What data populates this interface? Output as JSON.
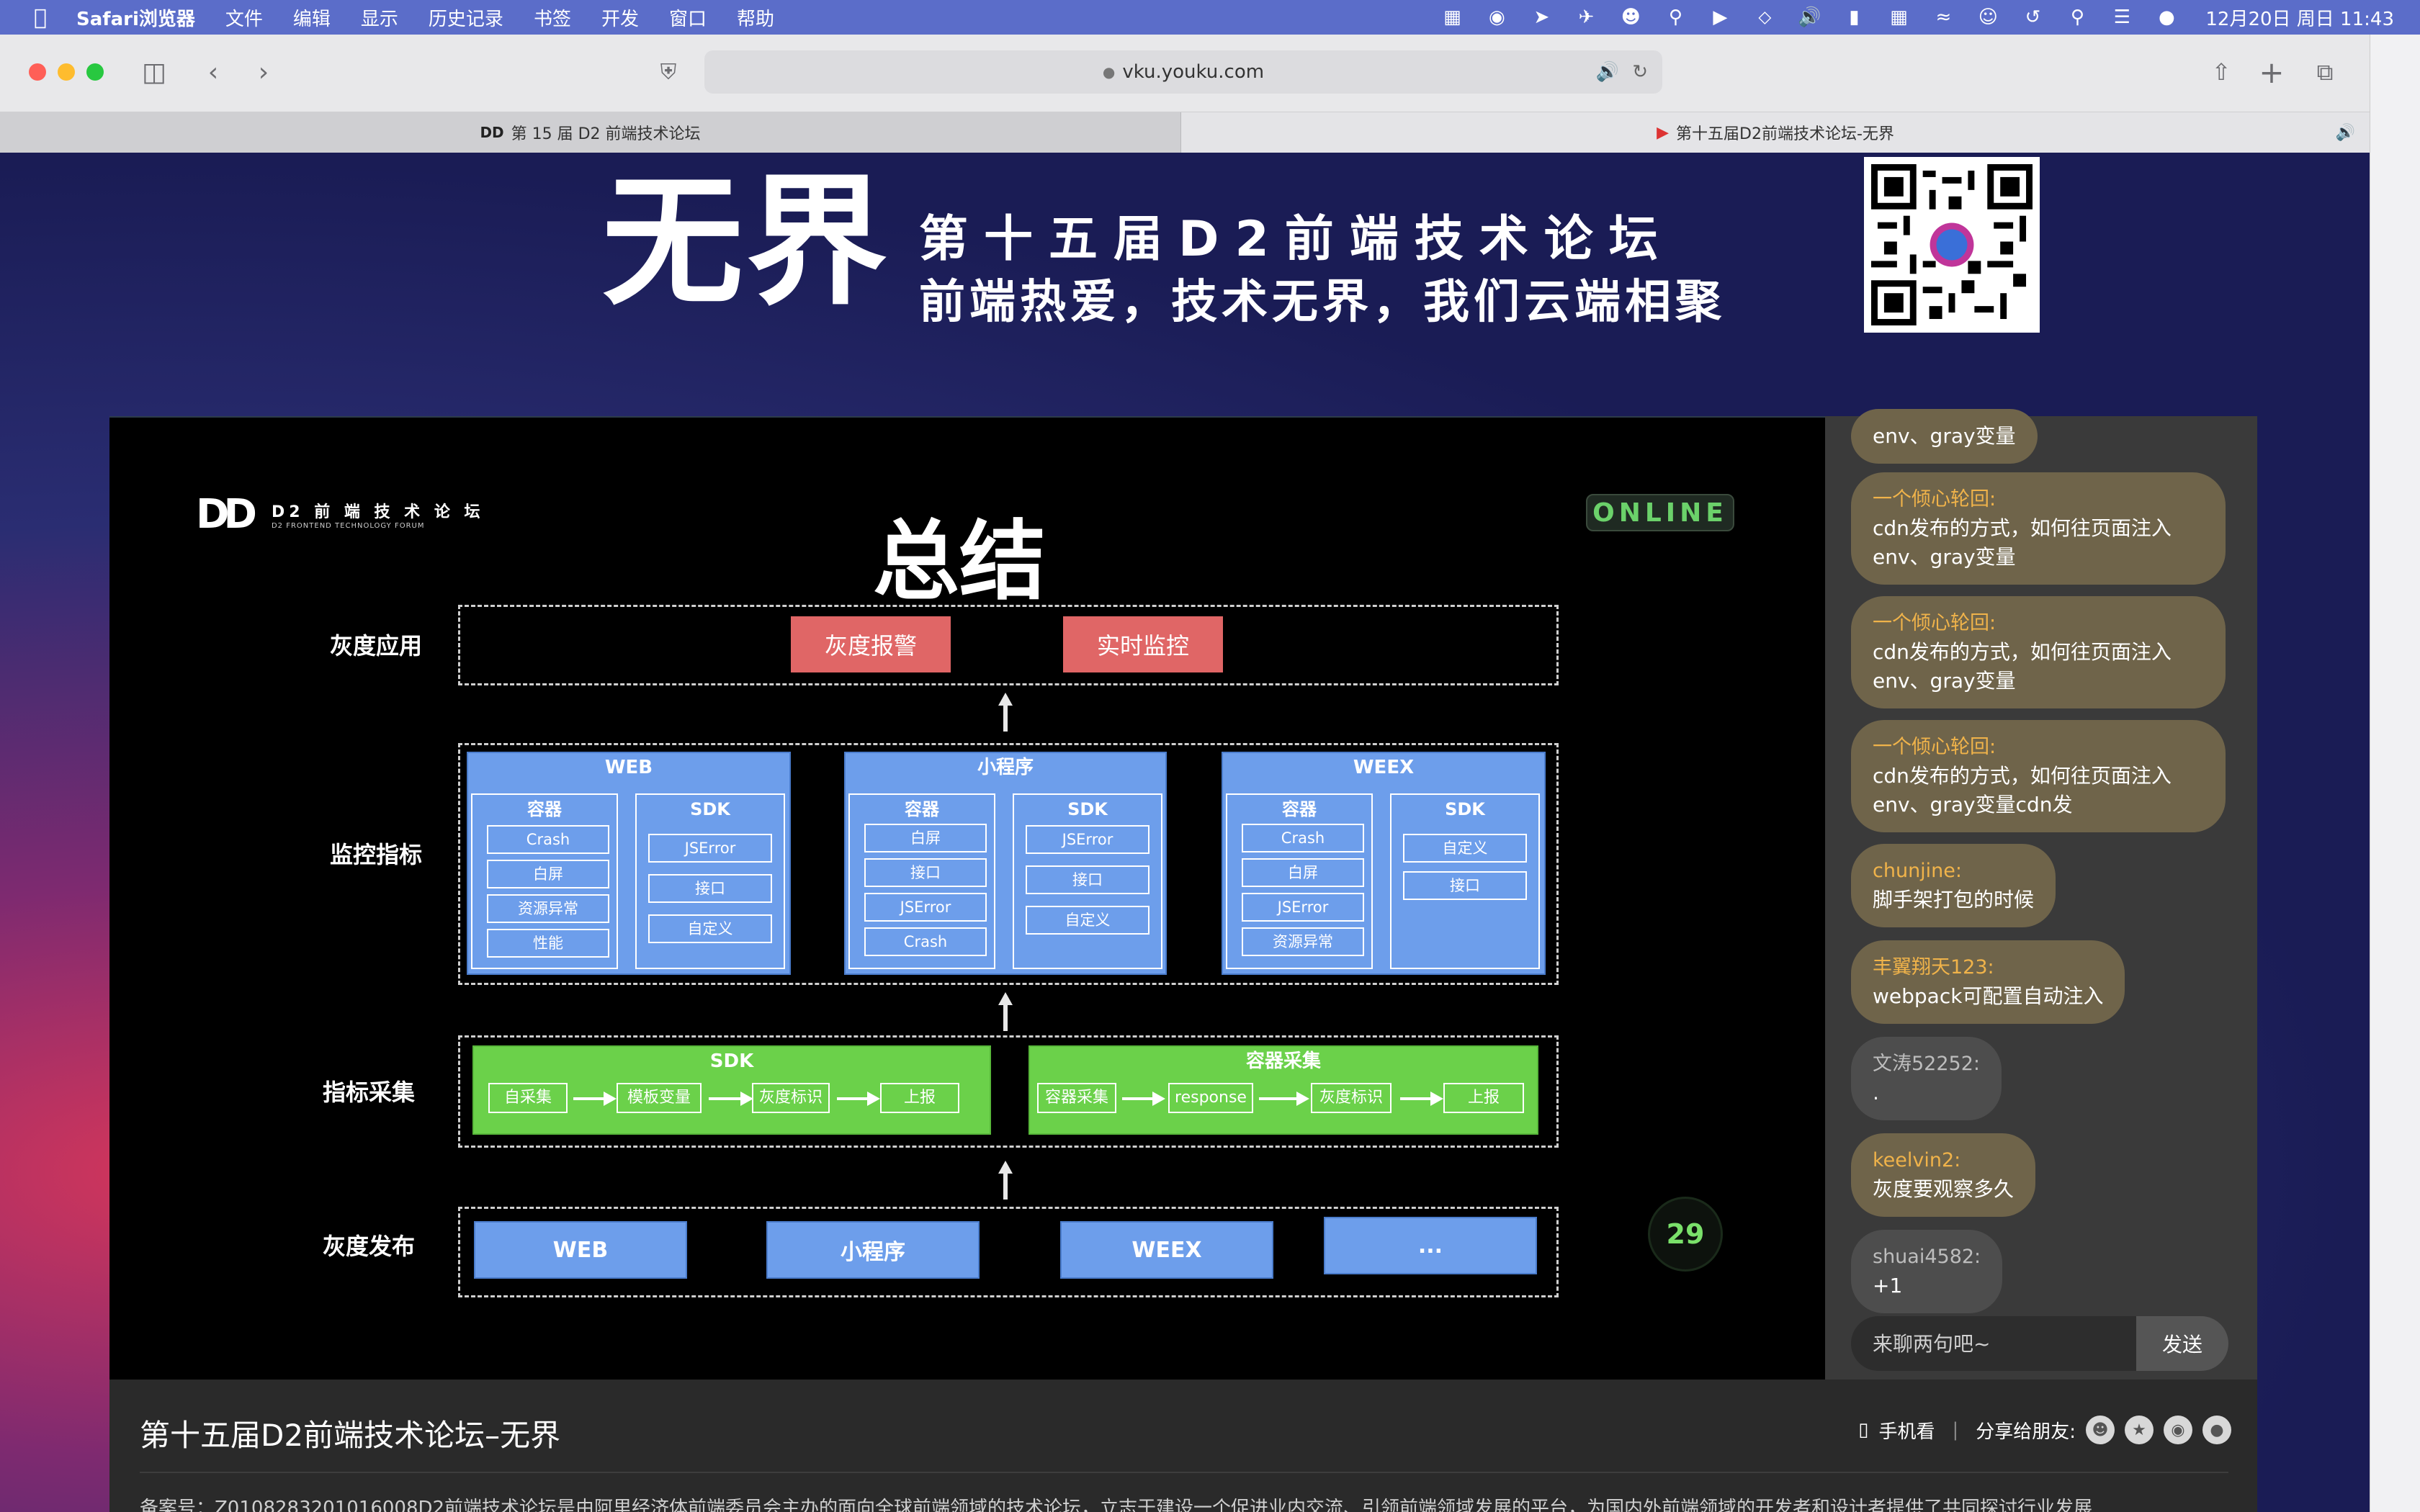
{
  "menubar": {
    "app": "Safari浏览器",
    "items": [
      "文件",
      "编辑",
      "显示",
      "历史记录",
      "书签",
      "开发",
      "窗口",
      "帮助"
    ],
    "clock": "12月20日 周日 11:43"
  },
  "browser": {
    "url": "vku.youku.com",
    "tabs": [
      {
        "label": "第 15 届 D2 前端技术论坛"
      },
      {
        "label": "第十五届D2前端技术论坛-无界"
      }
    ]
  },
  "banner": {
    "big": "无界",
    "line1": "第十五届D2前端技术论坛",
    "line2": "前端热爱，技术无界，我们云端相聚"
  },
  "slide": {
    "logo_mark": "DD",
    "logo_text": "D2 前 端 技 术 论 坛",
    "logo_sub": "D2 FRONTEND TECHNOLOGY FORUM",
    "title": "总结",
    "badge": "ONLINE",
    "page_number": "29",
    "rows": {
      "apply": "灰度应用",
      "monitor": "监控指标",
      "collect": "指标采集",
      "release": "灰度发布"
    },
    "apply_buttons": [
      "灰度报警",
      "实时监控"
    ],
    "platforms": [
      {
        "title": "WEB",
        "left_title": "容器",
        "left_items": [
          "Crash",
          "白屏",
          "资源异常",
          "性能"
        ],
        "right_title": "SDK",
        "right_items": [
          "JSError",
          "接口",
          "自定义"
        ]
      },
      {
        "title": "小程序",
        "left_title": "容器",
        "left_items": [
          "白屏",
          "接口",
          "JSError",
          "Crash"
        ],
        "right_title": "SDK",
        "right_items": [
          "JSError",
          "接口",
          "自定义"
        ]
      },
      {
        "title": "WEEX",
        "left_title": "容器",
        "left_items": [
          "Crash",
          "白屏",
          "JSError",
          "资源异常"
        ],
        "right_title": "SDK",
        "right_items": [
          "自定义",
          "接口"
        ]
      }
    ],
    "collect_sdk": {
      "title": "SDK",
      "items": [
        "自采集",
        "模板变量",
        "灰度标识",
        "上报"
      ]
    },
    "collect_container": {
      "title": "容器采集",
      "items": [
        "容器采集",
        "response",
        "灰度标识",
        "上报"
      ]
    },
    "release_buttons": [
      "WEB",
      "小程序",
      "WEEX",
      "..."
    ]
  },
  "chat": {
    "messages": [
      {
        "nick": "",
        "text": "env、gray变量"
      },
      {
        "nick": "一个倾心轮回:",
        "text": "cdn发布的方式，如何往页面注入env、gray变量"
      },
      {
        "nick": "一个倾心轮回:",
        "text": "cdn发布的方式，如何往页面注入env、gray变量"
      },
      {
        "nick": "一个倾心轮回:",
        "text": "cdn发布的方式，如何往页面注入env、gray变量cdn发"
      },
      {
        "nick": "chunjine:",
        "text": "脚手架打包的时候"
      },
      {
        "nick": "丰翼翔天123:",
        "text": "webpack可配置自动注入"
      },
      {
        "nick": "文涛52252:",
        "text": "."
      },
      {
        "nick": "keelvin2:",
        "text": "灰度要观察多久"
      },
      {
        "nick": "shuai4582:",
        "text": "+1"
      }
    ],
    "input_placeholder": "来聊两句吧~",
    "send_label": "发送"
  },
  "info": {
    "title": "第十五届D2前端技术论坛–无界",
    "mobile_label": "手机看",
    "separator": "|",
    "share_label": "分享给朋友:",
    "record": "备案号：Z0108283201016008D2前端技术论坛是由阿里经济体前端委员会主办的面向全球前端领域的技术论坛，立志于建设一个促进业内交流、引领前端领域发展的平台，为国内外前端领域的开发者和设计者提供了共同探讨行业发展"
  }
}
